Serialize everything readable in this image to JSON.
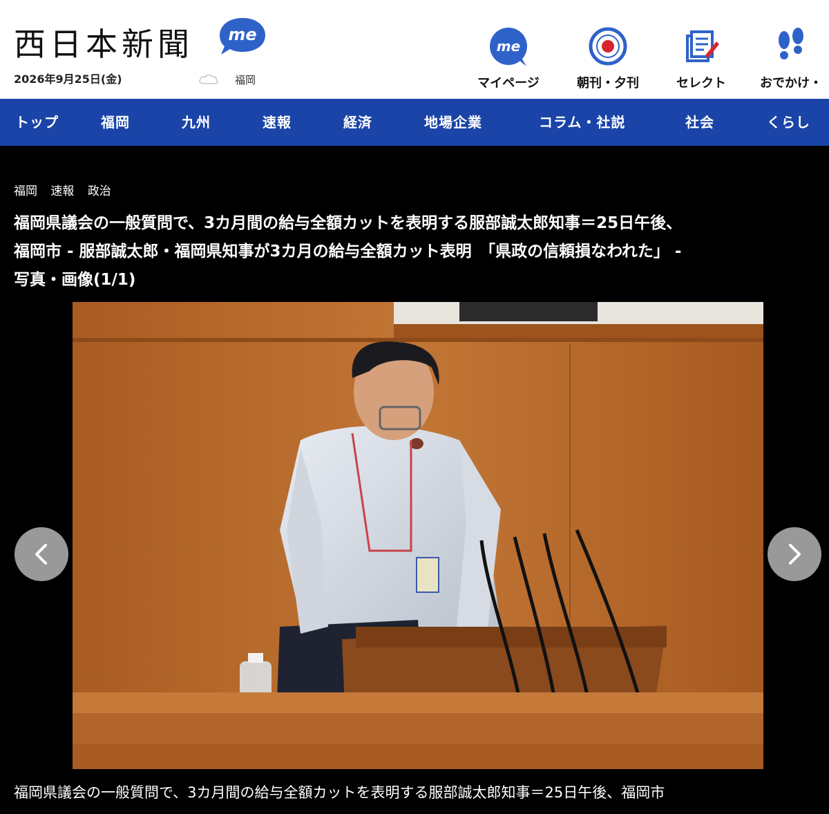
{
  "header": {
    "logo": "西日本新聞",
    "me_badge": "me",
    "date": "2026年9月25日(金)",
    "weather_icon": "cloud-icon",
    "city": "福岡",
    "nav": [
      {
        "label": "マイページ",
        "icon": "me-icon"
      },
      {
        "label": "朝刊・夕刊",
        "icon": "paper-edition-icon"
      },
      {
        "label": "セレクト",
        "icon": "select-icon"
      },
      {
        "label": "おでかけ・",
        "icon": "footprints-icon"
      }
    ]
  },
  "categories": [
    "トップ",
    "福岡",
    "九州",
    "速報",
    "経済",
    "地場企業",
    "コラム・社説",
    "社会",
    "くらし"
  ],
  "article": {
    "tags": [
      "福岡",
      "速報",
      "政治"
    ],
    "headline_lines": [
      "福岡県議会の一般質問で、3カ月間の給与全額カットを表明する服部誠太郎知事＝25日午後、",
      "福岡市 - 服部誠太郎・福岡県知事が3カ月の給与全額カット表明　「県政の信頼損なわれた」 -",
      "写真・画像(1/1)"
    ],
    "caption": "福岡県議会の一般質問で、3カ月間の給与全額カットを表明する服部誠太郎知事＝25日午後、福岡市"
  },
  "gallery": {
    "prev_icon": "chevron-left-icon",
    "next_icon": "chevron-right-icon"
  },
  "colors": {
    "nav_blue": "#1a44a8",
    "brand_blue": "#2f62c9",
    "page_bg": "#000000"
  }
}
